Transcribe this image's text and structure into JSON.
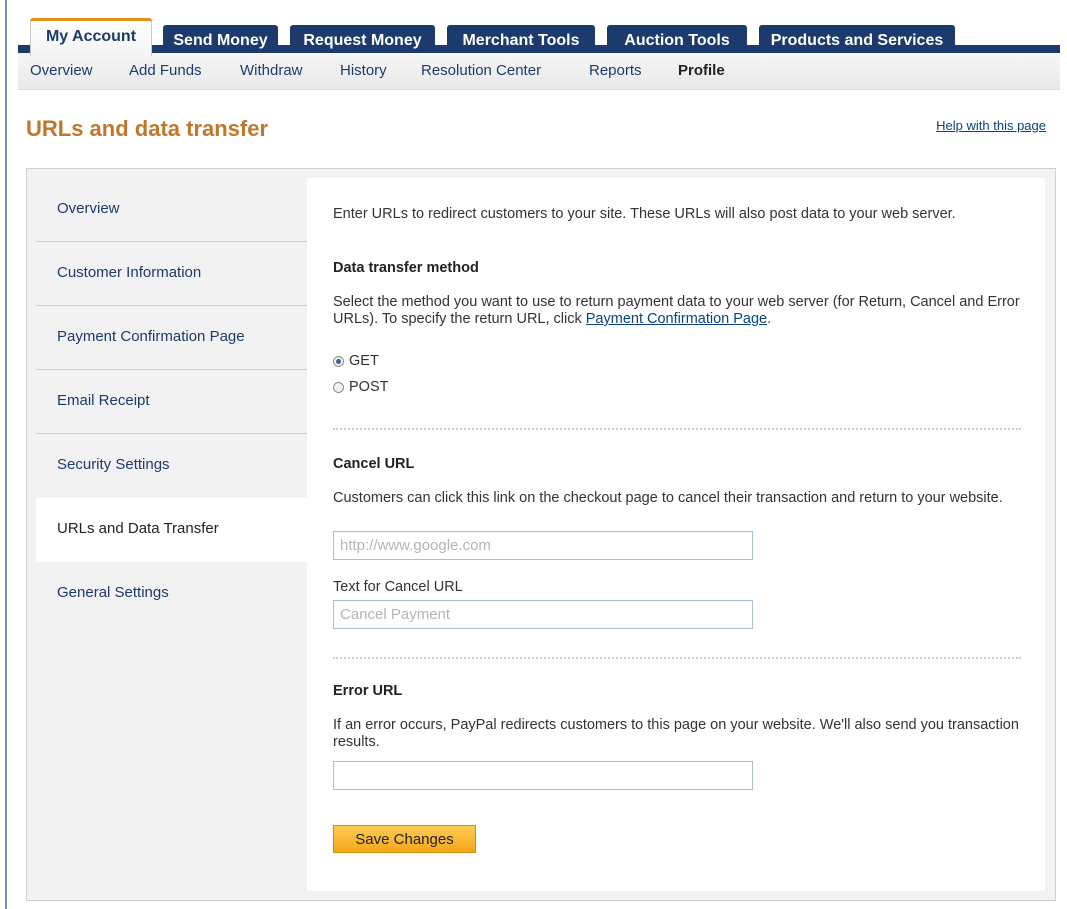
{
  "tabs": [
    {
      "label": "My Account",
      "active": true
    },
    {
      "label": "Send Money"
    },
    {
      "label": "Request Money"
    },
    {
      "label": "Merchant Tools"
    },
    {
      "label": "Auction Tools"
    },
    {
      "label": "Products and Services"
    }
  ],
  "subnav": [
    "Overview",
    "Add Funds",
    "Withdraw",
    "History",
    "Resolution Center",
    "Reports",
    "Profile"
  ],
  "subnav_active": "Profile",
  "page": {
    "title": "URLs and data transfer",
    "help_link": "Help with this page"
  },
  "side_nav": {
    "items": [
      "Overview",
      "Customer Information",
      "Payment Confirmation Page",
      "Email Receipt",
      "Security Settings",
      "URLs and Data Transfer",
      "General Settings"
    ],
    "active": "URLs and Data Transfer"
  },
  "content": {
    "intro": "Enter URLs to redirect customers to your site. These URLs will also post data to your web server.",
    "data_transfer": {
      "heading": "Data transfer method",
      "desc_before_link": "Select the method you want to use to return payment data to your web server (for Return, Cancel and Error URLs). To specify the return URL, click ",
      "link": "Payment Confirmation Page",
      "desc_after_link": ".",
      "options": [
        {
          "label": "GET",
          "checked": true
        },
        {
          "label": "POST",
          "checked": false
        }
      ]
    },
    "cancel": {
      "heading": "Cancel URL",
      "desc": "Customers can click this link on the checkout page to cancel their transaction and return to your website.",
      "url_placeholder": "http://www.google.com",
      "text_label": "Text for Cancel URL",
      "text_placeholder": "Cancel Payment"
    },
    "error": {
      "heading": "Error URL",
      "desc": "If an error occurs, PayPal redirects customers to this page on your website. We'll also send you transaction results.",
      "url_value": ""
    },
    "save_label": "Save Changes"
  },
  "colors": {
    "tab_bg": "#1c3b6c",
    "active_tab_accent": "#e38f1b",
    "title": "#c0772a",
    "link": "#084482",
    "button": "#f4a719"
  }
}
